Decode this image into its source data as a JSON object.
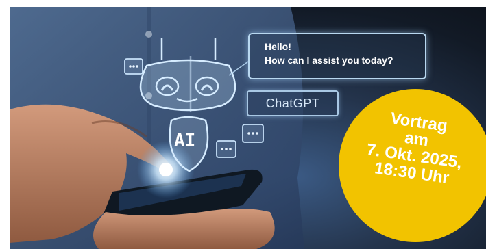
{
  "speech_bubble": {
    "line1": "Hello!",
    "line2": "How can I assist you today?"
  },
  "chat_label": "ChatGPT",
  "robot": {
    "chest_text": "AI"
  },
  "badge": {
    "lines": [
      "Vortrag",
      "am",
      "7. Okt. 2025,",
      "18:30 Uhr"
    ],
    "color": "#f2c300",
    "text_color": "#ffffff"
  },
  "icons": [
    "robot-icon",
    "chat-dots-icon",
    "smartphone-icon",
    "hand-icon"
  ]
}
